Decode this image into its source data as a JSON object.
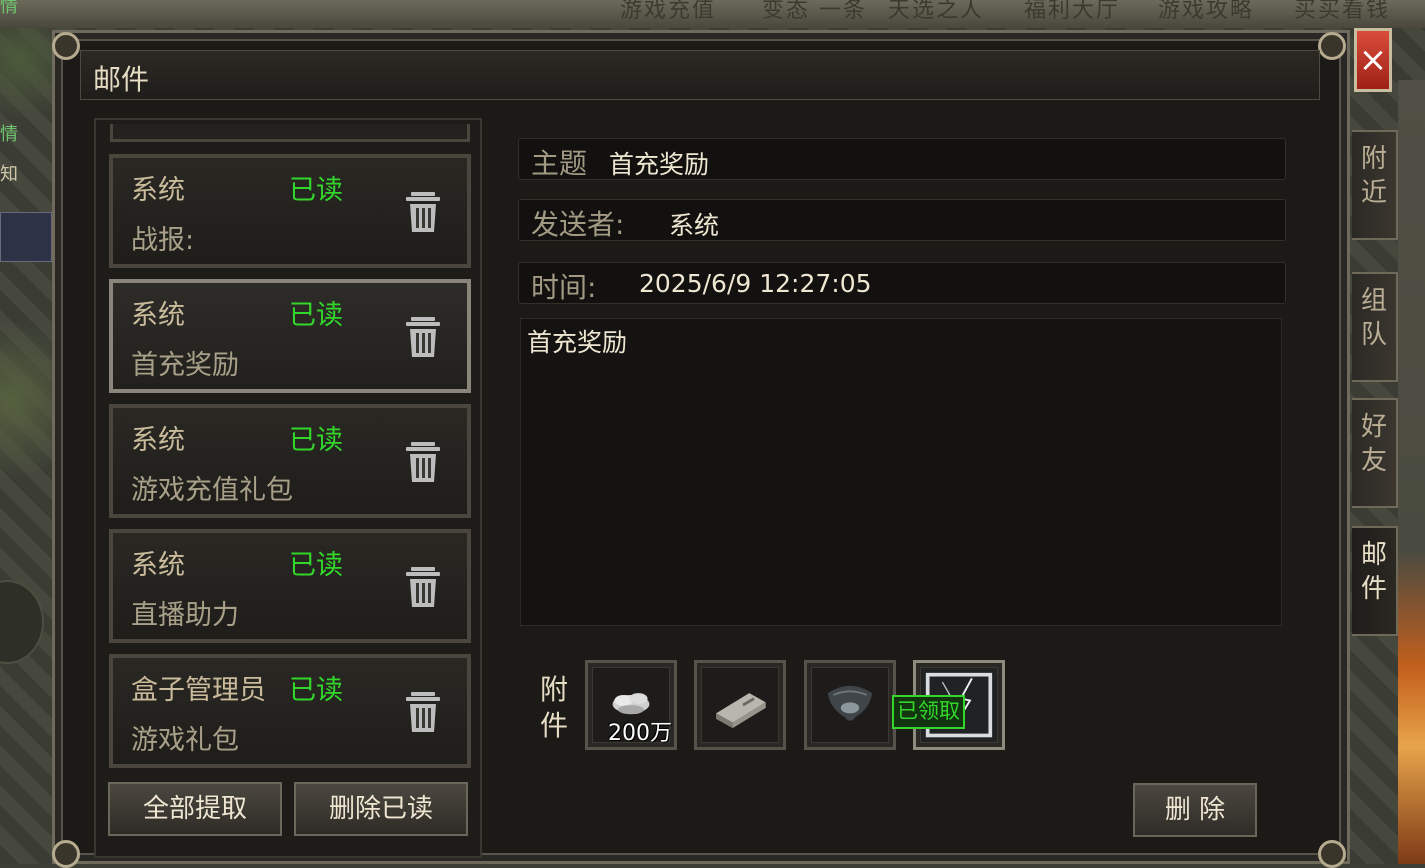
{
  "background": {
    "top_menu": [
      "游戏充值",
      "变态 一条",
      "天选之人",
      "福利大厅",
      "游戏攻略",
      "买买看钱"
    ],
    "left_texts": [
      "情",
      "情",
      "知"
    ]
  },
  "window": {
    "title": "邮件",
    "close_icon": "×"
  },
  "side_tabs": [
    {
      "label": [
        "附",
        "近"
      ],
      "active": false
    },
    {
      "label": [
        "组",
        "队"
      ],
      "active": false
    },
    {
      "label": [
        "好",
        "友"
      ],
      "active": false
    },
    {
      "label": [
        "邮",
        "件"
      ],
      "active": true
    }
  ],
  "mail_list": [
    {
      "sender": "系统",
      "status": "已读",
      "subject": "战报:",
      "selected": false
    },
    {
      "sender": "系统",
      "status": "已读",
      "subject": "首充奖励",
      "selected": true
    },
    {
      "sender": "系统",
      "status": "已读",
      "subject": "游戏充值礼包",
      "selected": false
    },
    {
      "sender": "系统",
      "status": "已读",
      "subject": "直播助力",
      "selected": false
    },
    {
      "sender": "盒子管理员",
      "status": "已读",
      "subject": "游戏礼包",
      "selected": false
    }
  ],
  "list_buttons": {
    "claim_all": "全部提取",
    "delete_read": "删除已读"
  },
  "detail": {
    "subject_label": "主题",
    "subject_value": "首充奖励",
    "sender_label": "发送者:",
    "sender_value": "系统",
    "time_label": "时间:",
    "time_value": "2025/6/9 12:27:05",
    "body": "首充奖励",
    "attachments_label": [
      "附",
      "件"
    ],
    "attachments": [
      {
        "icon": "silver-coins-icon",
        "count": "200万",
        "claimed_text": ""
      },
      {
        "icon": "scroll-book-icon",
        "count": "",
        "claimed_text": ""
      },
      {
        "icon": "dark-amulet-icon",
        "count": "",
        "claimed_text": ""
      },
      {
        "icon": "lightning-frame-icon",
        "count": "",
        "claimed_text": "已领取"
      }
    ],
    "delete_button": "删 除"
  },
  "colors": {
    "read_status": "#33d62b",
    "close_button": "#c9301f"
  }
}
